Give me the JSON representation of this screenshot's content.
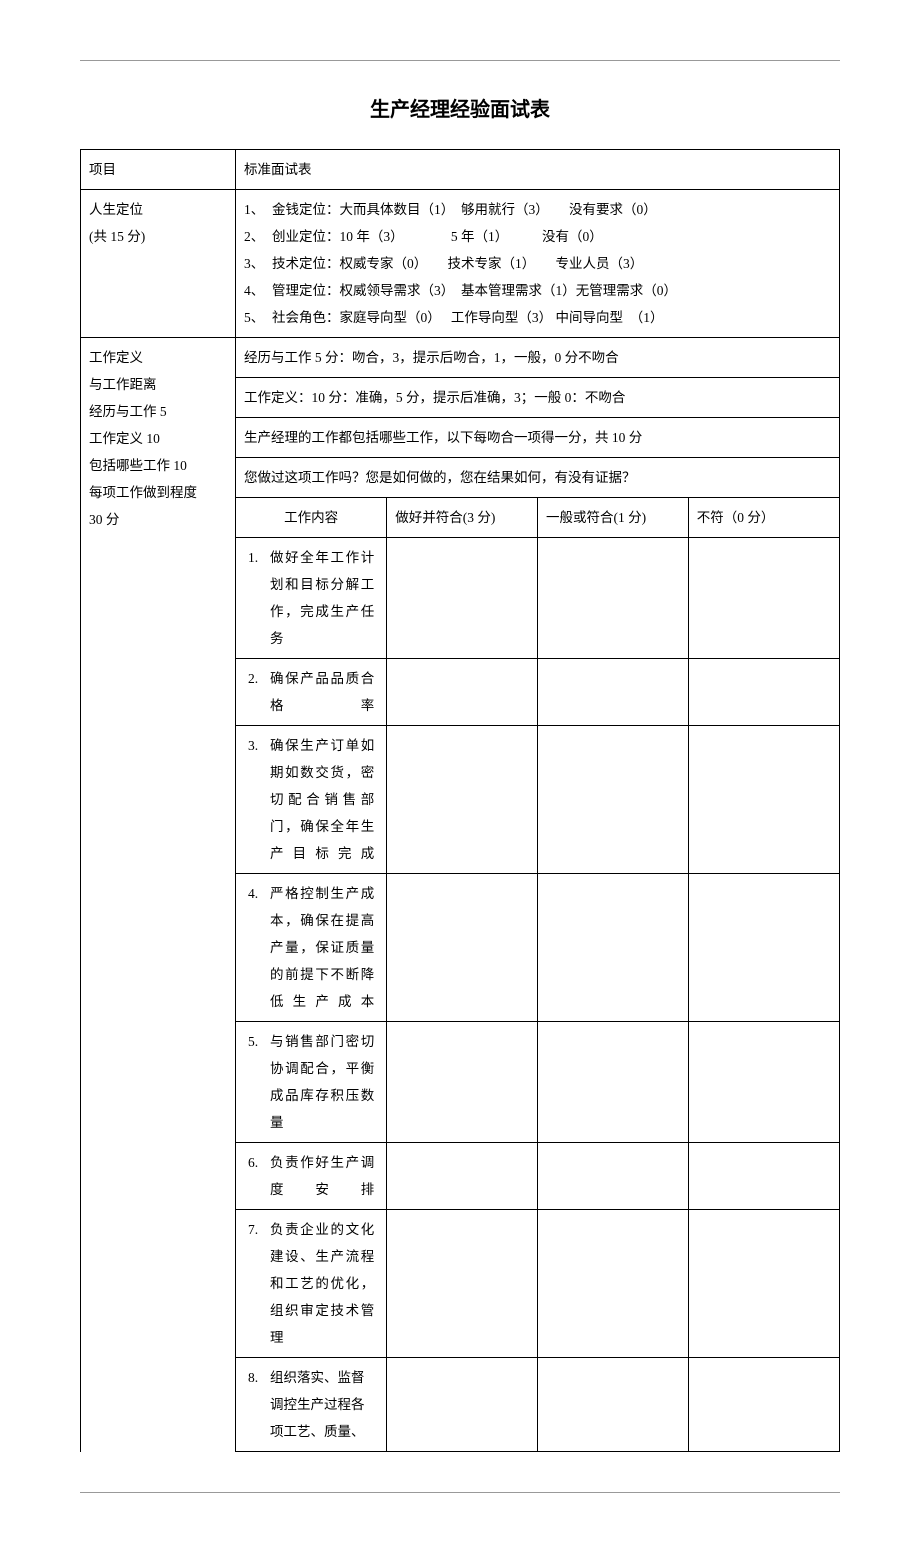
{
  "title": "生产经理经验面试表",
  "header": {
    "left": "项目",
    "right": "标准面试表"
  },
  "section1": {
    "label_line1": "人生定位",
    "label_line2": "(共 15 分)",
    "items": [
      {
        "n": "1、",
        "t": "金钱定位：大而具体数目（1）　够用就行（3）　　没有要求（0）"
      },
      {
        "n": "2、",
        "t": "创业定位：10 年（3）　　　　5 年（1）　　　没有（0）"
      },
      {
        "n": "3、",
        "t": "技术定位：权威专家（0）　　技术专家（1）　　专业人员（3）"
      },
      {
        "n": "4、",
        "t": "管理定位：权威领导需求（3）　基本管理需求（1）无管理需求（0）"
      },
      {
        "n": "5、",
        "t": "社会角色：家庭导向型（0）　 工作导向型（3）  中间导向型　（1）"
      }
    ]
  },
  "section2": {
    "labels": [
      "工作定义",
      "与工作距离",
      "经历与工作 5",
      "工作定义 10",
      "包括哪些工作 10",
      "每项工作做到程度",
      "30 分"
    ],
    "row1": "经历与工作 5 分：吻合，3，提示后吻合，1，一般，0 分不吻合",
    "row2": "工作定义：10 分：准确，5 分，提示后准确，3；一般 0：不吻合",
    "row3": "生产经理的工作都包括哪些工作，以下每吻合一项得一分，共 10 分",
    "row4": "您做过这项工作吗？您是如何做的，您在结果如何，有没有证据？",
    "cols": {
      "c1": "工作内容",
      "c2": "做好并符合(3 分)",
      "c3": "一般或符合(1 分)",
      "c4": "不符（0 分）"
    },
    "items": [
      {
        "n": "1.",
        "t": "做好全年工作计划和目标分解工作，完成生产任务",
        "noj": false
      },
      {
        "n": "2.",
        "t": "确保产品品质合格率",
        "noj": false
      },
      {
        "n": "3.",
        "t": "确保生产订单如期如数交货，密切配合销售部门，确保全年生产目标完成",
        "noj": false
      },
      {
        "n": "4.",
        "t": "严格控制生产成本，确保在提高产量，保证质量的前提下不断降低生产成本",
        "noj": false
      },
      {
        "n": "5.",
        "t": "与销售部门密切协调配合，平衡成品库存积压数量",
        "noj": false
      },
      {
        "n": "6.",
        "t": "负责作好生产调度安排",
        "noj": false
      },
      {
        "n": "7.",
        "t": "负责企业的文化建设、生产流程和工艺的优化，组织审定技术管理",
        "noj": false
      },
      {
        "n": "8.",
        "t": "组织落实、监督调控生产过程各项工艺、质量、",
        "noj": true
      }
    ]
  }
}
